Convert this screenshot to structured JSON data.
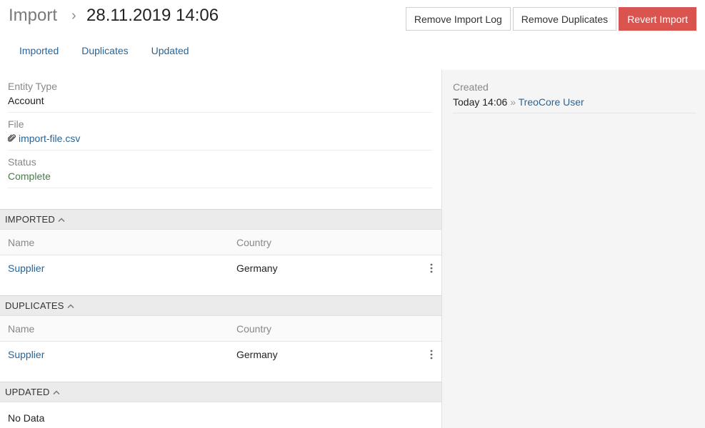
{
  "header": {
    "breadcrumb_root": "Import",
    "breadcrumb_sep": "›",
    "title": "28.11.2019 14:06",
    "buttons": {
      "remove_log": "Remove Import Log",
      "remove_duplicates": "Remove Duplicates",
      "revert": "Revert Import"
    }
  },
  "tabs": [
    "Imported",
    "Duplicates",
    "Updated"
  ],
  "fields": {
    "entity_type": {
      "label": "Entity Type",
      "value": "Account"
    },
    "file": {
      "label": "File",
      "value": "import-file.csv"
    },
    "status": {
      "label": "Status",
      "value": "Complete"
    }
  },
  "side": {
    "created_label": "Created",
    "created_time": "Today 14:06",
    "created_sep": "»",
    "created_by": "TreoCore User"
  },
  "panels": {
    "imported": {
      "title": "IMPORTED",
      "columns": [
        "Name",
        "Country"
      ],
      "rows": [
        {
          "name": "Supplier",
          "country": "Germany"
        }
      ]
    },
    "duplicates": {
      "title": "DUPLICATES",
      "columns": [
        "Name",
        "Country"
      ],
      "rows": [
        {
          "name": "Supplier",
          "country": "Germany"
        }
      ]
    },
    "updated": {
      "title": "UPDATED",
      "empty_text": "No Data"
    }
  },
  "colors": {
    "link": "#2a6496",
    "danger": "#d9534f",
    "status_complete": "#4a7a4a",
    "panel_header_bg": "#ebebeb",
    "side_bg": "#f5f5f5"
  },
  "icons": [
    "paperclip-icon",
    "chevron-up-icon",
    "kebab-menu-icon"
  ]
}
